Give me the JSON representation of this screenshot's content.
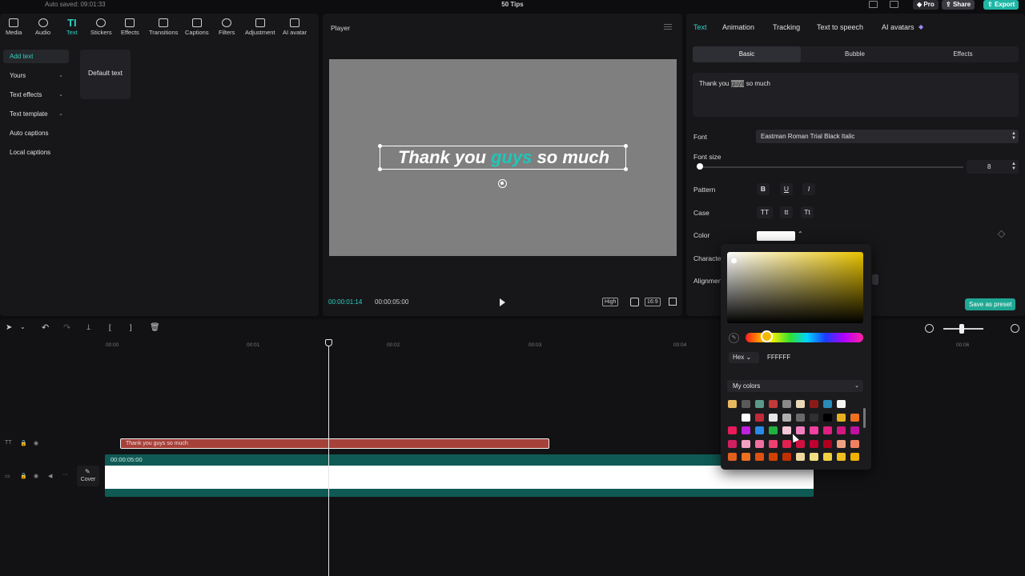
{
  "app": {
    "autosave": "Auto saved: 09:01:33",
    "project_title": "50 Tips"
  },
  "titlebar": {
    "pro": "Pro",
    "share": "Share",
    "export": "Export"
  },
  "toolbar": [
    {
      "label": "Media",
      "icon": "media-icon"
    },
    {
      "label": "Audio",
      "icon": "audio-icon"
    },
    {
      "label": "Text",
      "icon": "text-icon",
      "active": true
    },
    {
      "label": "Stickers",
      "icon": "stickers-icon"
    },
    {
      "label": "Effects",
      "icon": "effects-icon"
    },
    {
      "label": "Transitions",
      "icon": "transitions-icon"
    },
    {
      "label": "Captions",
      "icon": "captions-icon"
    },
    {
      "label": "Filters",
      "icon": "filters-icon"
    },
    {
      "label": "Adjustment",
      "icon": "adjustment-icon"
    },
    {
      "label": "AI avatar",
      "icon": "ai-avatar-icon"
    }
  ],
  "side_menu": [
    {
      "label": "Add text",
      "active": true
    },
    {
      "label": "Yours",
      "dropdown": true
    },
    {
      "label": "Text effects",
      "dropdown": true
    },
    {
      "label": "Text template",
      "dropdown": true
    },
    {
      "label": "Auto captions"
    },
    {
      "label": "Local captions"
    }
  ],
  "default_text_card": "Default text",
  "player": {
    "title": "Player",
    "caption_before": "Thank you ",
    "caption_highlight": "guys",
    "caption_after": " so much",
    "current_time": "00:00:01:14",
    "total_time": "00:00:05:00",
    "quality": "High",
    "ratio": "16:9"
  },
  "right_panel": {
    "tabs": [
      "Text",
      "Animation",
      "Tracking",
      "Text to speech",
      "AI avatars"
    ],
    "subtabs": [
      "Basic",
      "Bubble",
      "Effects"
    ],
    "text_before": "Thank you ",
    "text_selected": "guys",
    "text_after": " so much",
    "font_label": "Font",
    "font_value": "Eastman Roman Trial Black Italic",
    "font_size_label": "Font size",
    "font_size_value": "8",
    "font_size_fraction": 0.01,
    "pattern_label": "Pattern",
    "pattern_buttons": [
      "B",
      "U",
      "I"
    ],
    "case_label": "Case",
    "case_buttons": [
      "TT",
      "tt",
      "Tt"
    ],
    "color_label": "Color",
    "color_value": "#FFFFFF",
    "character_label": "Character",
    "alignment_label": "Alignment",
    "save_preset": "Save as preset"
  },
  "timeline": {
    "ruler": [
      "00:00",
      "00:01",
      "00:02",
      "00:03",
      "00:04",
      "00:06"
    ],
    "text_clip": "Thank you guys so much",
    "video_duration": "00:00:05:00",
    "cover_label": "Cover"
  },
  "color_picker": {
    "mode": "Hex",
    "hex": "FFFFFF",
    "palette_label": "My colors",
    "hue_color": "#e8c200",
    "swatches": [
      [
        "#e8b860",
        "#5a5a5a",
        "#5a9a8a",
        "#c23a3a",
        "#8a8a8a",
        "#e8d8b8",
        "#8a1a1a",
        "#2a8ab8",
        "#f4f4f4",
        "#1b1b1e"
      ],
      [
        "#1b1b1e",
        "#ffffff",
        "#c22a3a",
        "#e6e6e6",
        "#b0b0b0",
        "#6a6a6a",
        "#303030",
        "#000000",
        "#e6b020",
        "#f07020"
      ],
      [
        "#e81a5a",
        "#c020e0",
        "#2a8ae8",
        "#20b040",
        "#f2c8d8",
        "#f080c0",
        "#f040a0",
        "#e02080",
        "#d01880",
        "#c010a0"
      ],
      [
        "#d02060",
        "#f0a0c0",
        "#f070a0",
        "#f04070",
        "#e02050",
        "#d01040",
        "#c00030",
        "#b00020",
        "#f0a080",
        "#f08060"
      ],
      [
        "#e06020",
        "#f07020",
        "#e05010",
        "#d04000",
        "#c03000",
        "#f0d8a0",
        "#f0e080",
        "#f0d040",
        "#f0c020",
        "#f0b000"
      ]
    ]
  }
}
